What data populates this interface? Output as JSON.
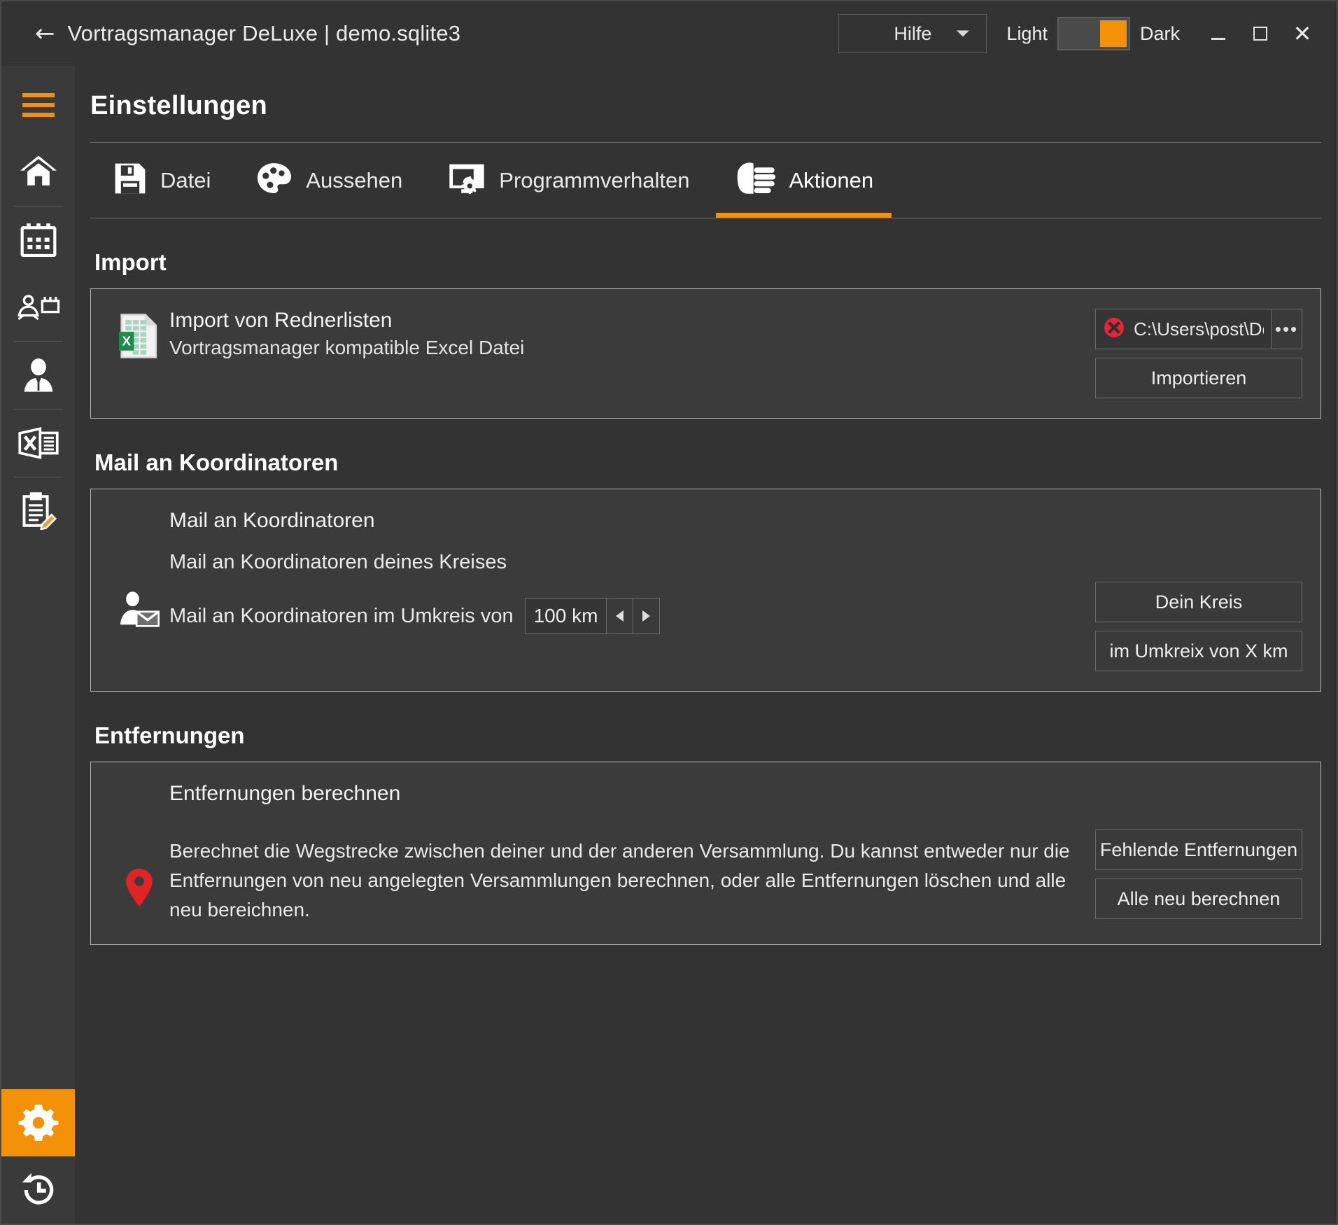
{
  "titlebar": {
    "back_icon": "back-arrow-icon",
    "title": "Vortragsmanager DeLuxe | demo.sqlite3",
    "help_label": "Hilfe",
    "light_label": "Light",
    "dark_label": "Dark",
    "theme_active": "Dark",
    "minimize_label": "–",
    "maximize_label": "□",
    "close_label": "✕"
  },
  "sidebar": {
    "items": [
      {
        "name": "menu-toggle",
        "icon": "hamburger-icon"
      },
      {
        "name": "home",
        "icon": "home-icon"
      },
      {
        "name": "calendar",
        "icon": "calendar-icon"
      },
      {
        "name": "speakers",
        "icon": "speaker-podium-icon"
      },
      {
        "name": "person",
        "icon": "person-icon"
      },
      {
        "name": "excel-export",
        "icon": "excel-icon"
      },
      {
        "name": "notes",
        "icon": "clipboard-edit-icon"
      },
      {
        "name": "settings",
        "icon": "gear-icon",
        "active": true
      },
      {
        "name": "history",
        "icon": "history-clock-icon"
      }
    ]
  },
  "page": {
    "title": "Einstellungen",
    "tabs": [
      {
        "label": "Datei",
        "icon": "floppy-disk-icon",
        "active": false
      },
      {
        "label": "Aussehen",
        "icon": "palette-icon",
        "active": false
      },
      {
        "label": "Programmverhalten",
        "icon": "monitor-gear-icon",
        "active": false
      },
      {
        "label": "Aktionen",
        "icon": "pointing-hand-icon",
        "active": true
      }
    ]
  },
  "import_section": {
    "heading": "Import",
    "item_title": "Import von Rednerlisten",
    "item_subtitle": "Vortragsmanager kompatible Excel Datei",
    "icon": "excel-file-icon",
    "status_icon": "error-circle-x-icon",
    "path_value": "C:\\Users\\post\\Docu",
    "browse_label": "•••",
    "import_button": "Importieren"
  },
  "mail_section": {
    "heading": "Mail an Koordinatoren",
    "item_title": "Mail an Koordinatoren",
    "icon": "person-mail-icon",
    "line1_label": "Mail an Koordinatoren deines Kreises",
    "line2_label": "Mail an Koordinatoren im Umkreis von",
    "radius_value": "100 km",
    "stepper_down_icon": "triangle-left-icon",
    "stepper_up_icon": "triangle-right-icon",
    "button_kreis": "Dein Kreis",
    "button_umkreis": "im Umkreix von X km"
  },
  "distance_section": {
    "heading": "Entfernungen",
    "item_title": "Entfernungen berechnen",
    "icon": "map-pin-icon",
    "description": "Berechnet die Wegstrecke zwischen deiner und der anderen Versammlung. Du kannst entweder nur die Entfernungen von neu angelegten Versammlungen berechnen, oder alle Entfernungen löschen und alle neu bereichnen.",
    "button_missing": "Fehlende Entfernungen",
    "button_all": "Alle neu berechnen"
  },
  "colors": {
    "accent": "#f39108",
    "window_bg": "#333333",
    "sidebar_bg": "#3a3a3a",
    "panel_border": "#b8b8b8",
    "error_red": "#e8243c",
    "pin_red": "#e02424",
    "excel_green": "#1f8b4c"
  }
}
